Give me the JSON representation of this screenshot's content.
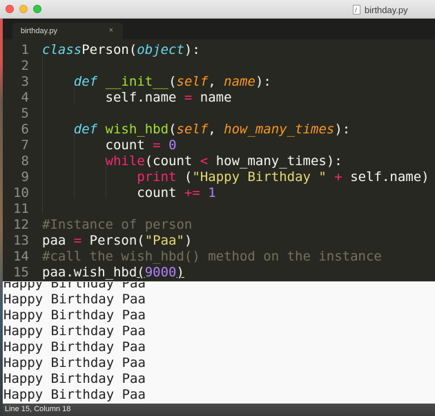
{
  "window": {
    "title": "birthday.py"
  },
  "tab": {
    "label": "birthday.py",
    "close": "×"
  },
  "editor": {
    "lines": [
      {
        "n": "1",
        "tokens": [
          [
            "kw",
            "class"
          ],
          [
            "",
            "Person("
          ],
          [
            "kw",
            "object"
          ],
          [
            "",
            "):"
          ]
        ]
      },
      {
        "n": "2",
        "tokens": []
      },
      {
        "n": "3",
        "tokens": [
          [
            "",
            "    "
          ],
          [
            "kw",
            "def"
          ],
          [
            "",
            " "
          ],
          [
            "fn",
            "__init__"
          ],
          [
            "",
            "("
          ],
          [
            "par",
            "self"
          ],
          [
            "",
            ", "
          ],
          [
            "par",
            "name"
          ],
          [
            "",
            "):"
          ]
        ]
      },
      {
        "n": "4",
        "tokens": [
          [
            "",
            "        self.name "
          ],
          [
            "op",
            "="
          ],
          [
            "",
            " name"
          ]
        ]
      },
      {
        "n": "5",
        "tokens": []
      },
      {
        "n": "6",
        "tokens": [
          [
            "",
            "    "
          ],
          [
            "kw",
            "def"
          ],
          [
            "",
            " "
          ],
          [
            "fn",
            "wish_hbd"
          ],
          [
            "",
            "("
          ],
          [
            "par",
            "self"
          ],
          [
            "",
            ", "
          ],
          [
            "par",
            "how_many_times"
          ],
          [
            "",
            "):"
          ]
        ]
      },
      {
        "n": "7",
        "tokens": [
          [
            "",
            "        count "
          ],
          [
            "op",
            "="
          ],
          [
            "",
            " "
          ],
          [
            "num",
            "0"
          ]
        ]
      },
      {
        "n": "8",
        "tokens": [
          [
            "",
            "        "
          ],
          [
            "op",
            "while"
          ],
          [
            "",
            "(count "
          ],
          [
            "op",
            "<"
          ],
          [
            "",
            " how_many_times):"
          ]
        ]
      },
      {
        "n": "9",
        "tokens": [
          [
            "",
            "            "
          ],
          [
            "op",
            "print"
          ],
          [
            "",
            " ("
          ],
          [
            "str",
            "\"Happy Birthday \""
          ],
          [
            "",
            " "
          ],
          [
            "op",
            "+"
          ],
          [
            "",
            " self.name)"
          ]
        ]
      },
      {
        "n": "10",
        "tokens": [
          [
            "",
            "            count "
          ],
          [
            "op",
            "+="
          ],
          [
            "",
            " "
          ],
          [
            "num",
            "1"
          ]
        ]
      },
      {
        "n": "11",
        "tokens": []
      },
      {
        "n": "12",
        "tokens": [
          [
            "cm",
            "#Instance of person"
          ]
        ]
      },
      {
        "n": "13",
        "tokens": [
          [
            "",
            "paa "
          ],
          [
            "op",
            "="
          ],
          [
            "",
            " Person("
          ],
          [
            "str",
            "\"Paa\""
          ],
          [
            "",
            ")"
          ]
        ]
      },
      {
        "n": "14",
        "tokens": [
          [
            "cm",
            "#call the wish_hbd() method on the instance"
          ]
        ]
      },
      {
        "n": "15",
        "tokens": [
          [
            "",
            "paa.wish_hbd"
          ],
          [
            "ul",
            "("
          ],
          [
            "num",
            "9000"
          ],
          [
            "ul",
            ")"
          ]
        ]
      }
    ]
  },
  "output": {
    "lines": [
      "Happy Birthday Paa",
      "Happy Birthday Paa",
      "Happy Birthday Paa",
      "Happy Birthday Paa",
      "Happy Birthday Paa",
      "Happy Birthday Paa",
      "Happy Birthday Paa",
      "Happy Birthday Paa"
    ]
  },
  "status": {
    "text": "Line 15, Column 18"
  },
  "colors": {
    "editor_bg": "#272822",
    "keyword": "#66d9ef",
    "function": "#a6e22e",
    "parameter": "#fd971f",
    "operator": "#f92672",
    "number": "#ae81ff",
    "string": "#e6db74",
    "comment": "#75715e"
  }
}
